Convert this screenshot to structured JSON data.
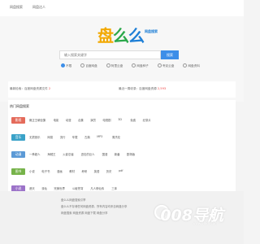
{
  "nav": {
    "home": "网盘搜索",
    "entry": "网盘达人"
  },
  "logo": {
    "text1": "盘",
    "text2": "么",
    "text3": "么",
    "sub": "网盘搜索"
  },
  "search": {
    "placeholder": "输入搜索关键字",
    "button": "搜索"
  },
  "options": [
    "不限",
    "百度网盘",
    "阿里云盘",
    "网盘种子",
    "夸克云盘",
    "网盘资料"
  ],
  "stats": {
    "left": "最新检索：百度网盘资源文件",
    "left_count": "2",
    "right": "最近一周收录：百度网盘资源",
    "right_count": "2,593"
  },
  "panel": {
    "title": "热门网盘搜索"
  },
  "rows": [
    {
      "tag": "影视",
      "color": "#e46b5b",
      "items": [
        "雍正王朝全集",
        "电影",
        "动漫",
        "合集",
        "演员",
        "电视剧",
        "3D",
        "免费",
        "纪录片"
      ]
    },
    {
      "tag": "音乐",
      "color": "#3aa2c8",
      "items": [
        "无损音乐",
        "网易",
        "流行",
        "车载",
        "古典",
        "MP3",
        "周杰伦"
      ]
    },
    {
      "tag": "动漫",
      "color": "#5c9ad6",
      "items": [
        "一拳超人",
        "海贼王",
        "火影忍者",
        "进击的巨人",
        "国漫",
        "新番",
        "剧场版"
      ]
    },
    {
      "tag": "图书",
      "color": "#76b34a",
      "items": [
        "小说",
        "电子书",
        "漫画",
        "教材",
        "考研",
        "英语",
        "历史",
        "pdf"
      ]
    },
    {
      "tag": "小说",
      "color": "#9c73c9",
      "items": [
        "遮天",
        "诛仙",
        "完美世界",
        "斗破苍穹",
        "凡人修仙传",
        "三体"
      ]
    }
  ],
  "footer": {
    "l1": "盘么么网盘搜索引擎",
    "l2": "盘么么不存储任何网盘资源，所有内容均来自网盘分享",
    "l3": "网盘搜索 网盘资源 网盘下载 网盘分享"
  },
  "watermark": {
    "main": "008导航",
    "sub": "www.008fl.com"
  }
}
